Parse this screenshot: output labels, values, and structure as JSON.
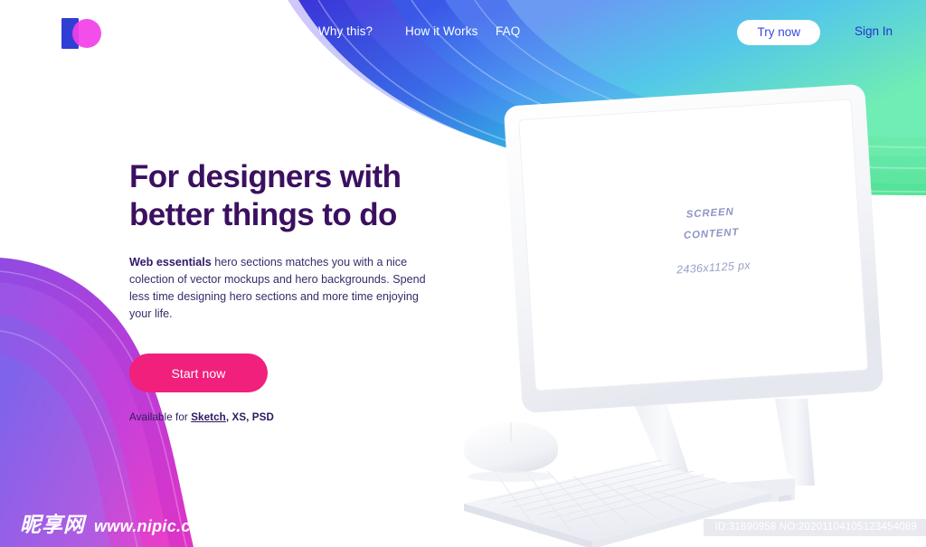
{
  "brand": {
    "logo_icon": "logo-mark-square-circle",
    "square_color": "#2f3fd4",
    "circle_color": "#f23fe8"
  },
  "nav": {
    "links": [
      {
        "label": "Why this?",
        "name": "nav-why-this"
      },
      {
        "label": "How it Works",
        "name": "nav-how-it-works"
      },
      {
        "label": "FAQ",
        "name": "nav-faq"
      }
    ],
    "try_now_label": "Try now",
    "sign_in_label": "Sign In",
    "link_color": "#ffffff",
    "try_now_text_color": "#3349e0",
    "sign_in_color": "#2b2fc9"
  },
  "hero": {
    "heading": "For designers with\nbetter things to do",
    "heading_color": "#3b1060",
    "lead_bold": "Web essentials",
    "lead_rest": " hero sections matches you with a nice colection of vector mockups and hero backgrounds. Spend less time designing hero sections and more time enjoying your life.",
    "cta_label": "Start now",
    "cta_color": "#f0207c",
    "available_prefix": "Available for ",
    "available_link": "Sketch",
    "available_suffix": ", XS, PSD"
  },
  "mockup": {
    "screen_line1": "SCREEN",
    "screen_line2": "CONTENT",
    "screen_dims": "2436x1125 px",
    "screen_text_color": "#8e94c4",
    "devices": [
      "monitor",
      "keyboard",
      "mouse",
      "base-unit"
    ]
  },
  "watermark": {
    "site_cn": "昵享网",
    "site_url": "www.nipic.cn",
    "id_line": "ID:31890958 NO:20201104105123454089"
  },
  "palette": {
    "wave_top_indigo": "#3d3fd6",
    "wave_top_blue": "#3f7fe8",
    "wave_top_cyan": "#35c6e0",
    "wave_top_green": "#4fe0a8",
    "wave_left_magenta": "#d934c8",
    "wave_left_purple": "#8e4fe0",
    "page_background": "#ffffff"
  }
}
